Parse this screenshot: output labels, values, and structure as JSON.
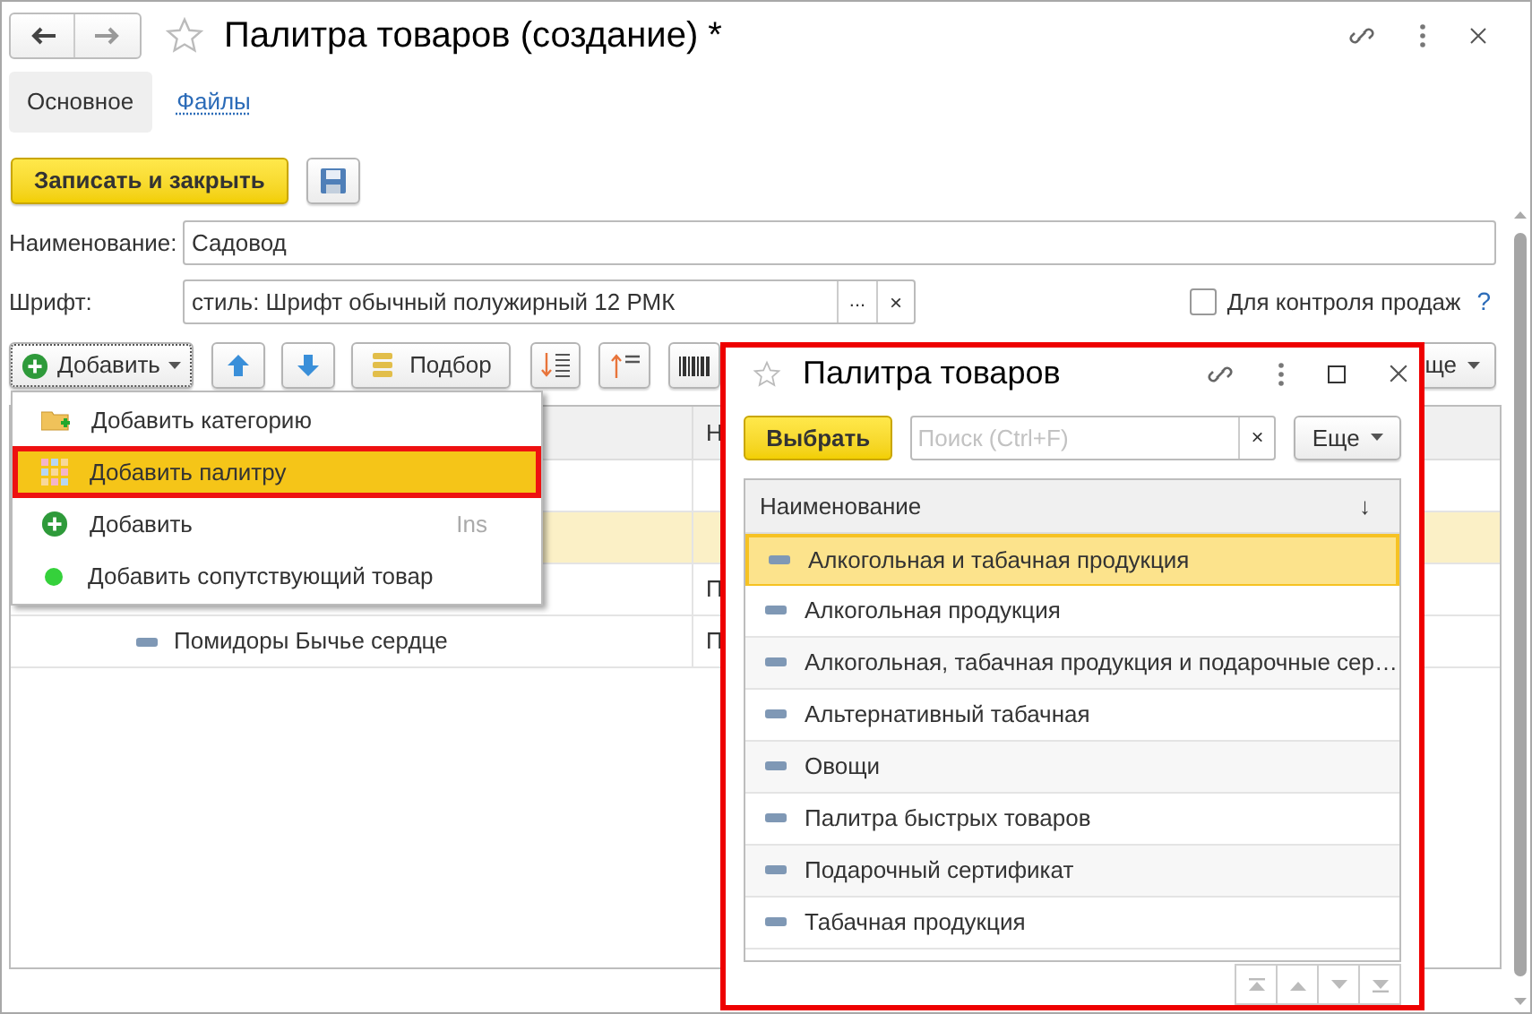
{
  "window": {
    "title": "Палитра товаров (создание) *"
  },
  "tabs": [
    {
      "label": "Основное",
      "selected": true
    },
    {
      "label": "Файлы",
      "selected": false
    }
  ],
  "actions": {
    "primary": "Записать и закрыть"
  },
  "fields": [
    {
      "kind": "text",
      "label": "Наименование:",
      "value": "Садовод"
    },
    {
      "kind": "choice",
      "label": "Шрифт:",
      "value": "стиль: Шрифт обычный полужирный 12 РМК",
      "select_button": "...",
      "clear_button": "×"
    }
  ],
  "sales_control": {
    "label": "Для контроля продаж",
    "checked": false,
    "help": "?"
  },
  "toolbar": {
    "add": "Добавить",
    "pick": "Подбор",
    "more": "ще"
  },
  "table": {
    "column_2_header": "Н",
    "rows": [
      {
        "selected": false
      },
      {
        "selected": true
      },
      {
        "column_2": "П",
        "selected": false
      },
      {
        "name": "Помидоры Бычье сердце",
        "column_2": "П",
        "selected": false
      }
    ]
  },
  "add_menu": {
    "items": [
      {
        "kind": "category",
        "label": "Добавить категорию",
        "selected": false
      },
      {
        "kind": "palette",
        "label": "Добавить палитру",
        "selected": true
      },
      {
        "kind": "add",
        "label": "Добавить",
        "shortcut": "Ins",
        "selected": false
      },
      {
        "kind": "related",
        "label": "Добавить сопутствующий товар",
        "selected": false
      }
    ]
  },
  "palette_window": {
    "title": "Палитра товаров",
    "choose": "Выбрать",
    "search": {
      "placeholder": "Поиск (Ctrl+F)"
    },
    "clear": "×",
    "more": "Еще",
    "column": "Наименование",
    "sort_mark": "↓",
    "rows": [
      {
        "label": "Алкогольная и табачная продукция",
        "selected": true
      },
      {
        "label": "Алкогольная продукция",
        "selected": false
      },
      {
        "label": "Алкогольная, табачная продукция и подарочные сер…",
        "selected": false
      },
      {
        "label": "Альтернативный табачная",
        "selected": false
      },
      {
        "label": "Овощи",
        "selected": false
      },
      {
        "label": "Палитра быстрых товаров",
        "selected": false
      },
      {
        "label": "Подарочный сертификат",
        "selected": false
      },
      {
        "label": "Табачная продукция",
        "selected": false
      }
    ]
  }
}
